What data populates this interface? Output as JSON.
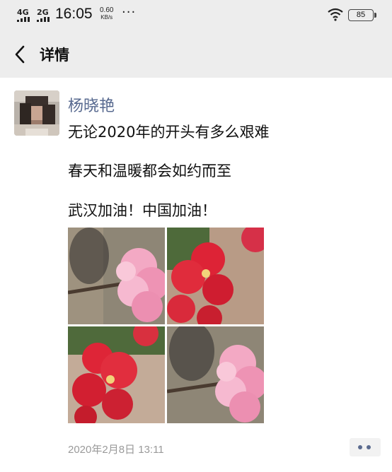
{
  "status_bar": {
    "network_1": "4G",
    "network_2": "2G",
    "time": "16:05",
    "speed_value": "0.60",
    "speed_unit": "KB/s",
    "more": "···",
    "battery": "85",
    "icons": [
      "signal-icon",
      "wifi-icon",
      "battery-icon"
    ]
  },
  "header": {
    "back_icon": "chevron-left-icon",
    "title": "详情"
  },
  "post": {
    "author": "杨晓艳",
    "lines": [
      "无论2020年的开头有多么艰难",
      "春天和温暖都会如约而至",
      "武汉加油！中国加油！"
    ],
    "photos": [
      "pink-blossom-photo",
      "red-blossom-photo",
      "red-blossom-photo",
      "pink-blossom-photo"
    ],
    "timestamp": "2020年2月8日 13:11",
    "more_icon": "more-dots-icon"
  },
  "colors": {
    "header_bg": "#ededed",
    "author_name": "#57698f",
    "timestamp": "#9a9a9a"
  }
}
